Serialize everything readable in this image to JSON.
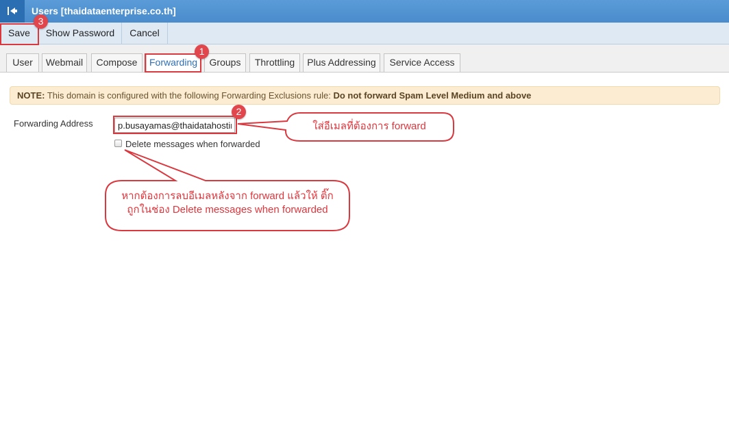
{
  "window": {
    "title": "Users [thaidataenterprise.co.th]",
    "back_icon": "collapse-left-icon"
  },
  "toolbar": {
    "save_label": "Save",
    "show_password_label": "Show Password",
    "cancel_label": "Cancel"
  },
  "tabs": [
    {
      "label": "User"
    },
    {
      "label": "Webmail"
    },
    {
      "label": "Compose"
    },
    {
      "label": "Forwarding",
      "active": true
    },
    {
      "label": "Groups"
    },
    {
      "label": "Throttling"
    },
    {
      "label": "Plus Addressing"
    },
    {
      "label": "Service Access"
    }
  ],
  "note": {
    "prefix": "NOTE:",
    "text": " This domain is configured with the following Forwarding Exclusions rule: ",
    "rule": "Do not forward Spam Level Medium and above"
  },
  "form": {
    "forwarding_label": "Forwarding Address",
    "forwarding_value": "p.busayamas@thaidatahosting",
    "delete_label": "Delete messages when forwarded",
    "delete_checked": false
  },
  "annotations": {
    "badges": [
      "1",
      "2",
      "3"
    ],
    "callout_1": "ใส่อีเมลที่ต้องการ forward",
    "callout_2_line1": "หากต้องการลบอีเมลหลังจาก forward แล้วให้ ติ๊ก",
    "callout_2_line2": "ถูกในช่อง Delete messages when forwarded",
    "color": "#e2343b"
  },
  "colors": {
    "titlebar": "#4a8ccc",
    "toolbar": "#dfe9f4",
    "active_tab_text": "#2e6fb7",
    "note_bg": "#fbecd2",
    "highlight": "#d9383f"
  }
}
